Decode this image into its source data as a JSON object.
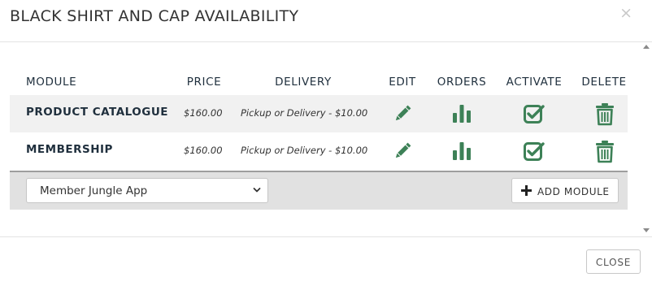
{
  "header": {
    "title": "BLACK SHIRT AND CAP AVAILABILITY",
    "close_symbol": "×"
  },
  "table": {
    "columns": {
      "module": "MODULE",
      "price": "PRICE",
      "delivery": "DELIVERY",
      "edit": "EDIT",
      "orders": "ORDERS",
      "activate": "ACTIVATE",
      "delete": "DELETE"
    },
    "rows": [
      {
        "module": "PRODUCT CATALOGUE",
        "price": "$160.00",
        "delivery": "Pickup or Delivery - $10.00"
      },
      {
        "module": "MEMBERSHIP",
        "price": "$160.00",
        "delivery": "Pickup or Delivery - $10.00"
      }
    ],
    "icons": {
      "edit": "pencil-icon",
      "orders": "bar-chart-icon",
      "activate": "check-square-icon",
      "delete": "trash-icon"
    }
  },
  "add_module": {
    "select_value": "Member Jungle App",
    "button_label": "ADD MODULE",
    "button_icon": "plus-icon"
  },
  "footer": {
    "close_label": "CLOSE"
  },
  "colors": {
    "icon_green": "#3d8157",
    "row_stripe": "#f1f1f1",
    "bar_gray": "#e1e1e1",
    "text": "#1f2f3d"
  }
}
